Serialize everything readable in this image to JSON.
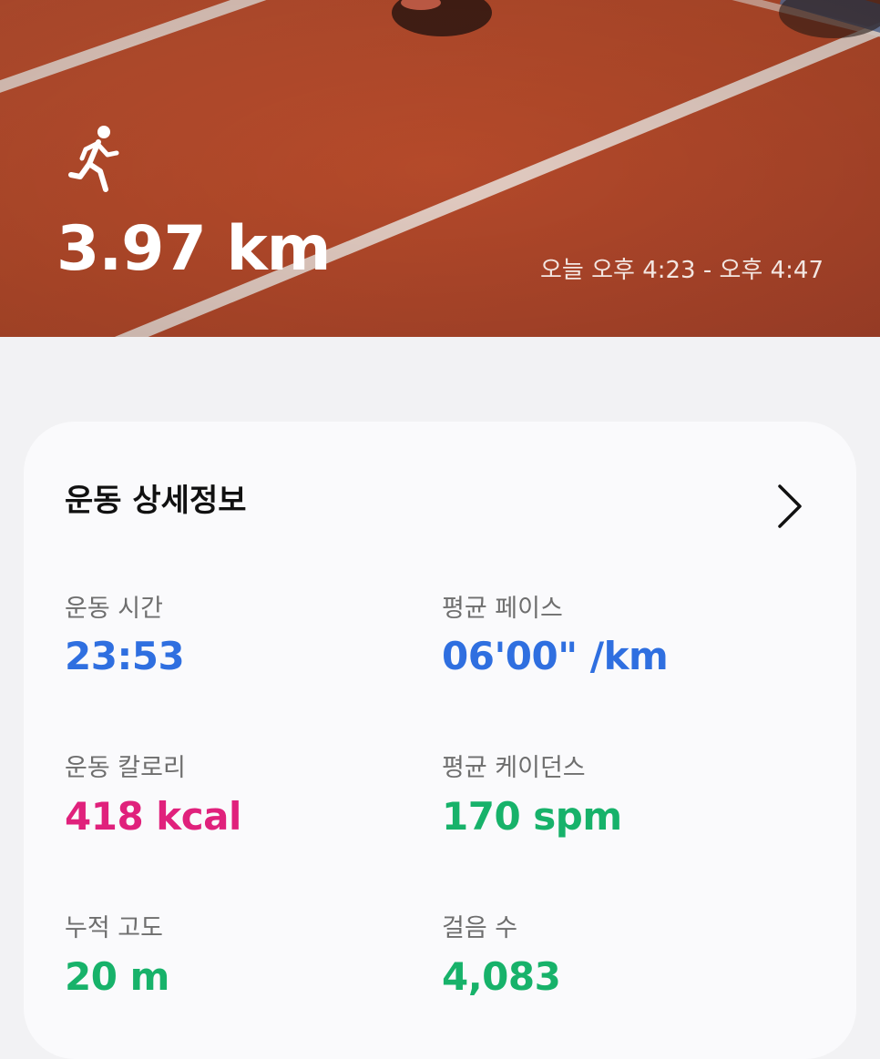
{
  "header": {
    "activity_icon": "running-person-icon",
    "distance": "3.97 km",
    "time_range": "오늘 오후 4:23 - 오후 4:47"
  },
  "details": {
    "title": "운동 상세정보",
    "chevron_icon": "chevron-right-icon",
    "stats": [
      {
        "label": "운동 시간",
        "value": "23:53",
        "color": "#2f6fe0"
      },
      {
        "label": "평균 페이스",
        "value": "06'00\" /km",
        "color": "#2f6fe0"
      },
      {
        "label": "운동 칼로리",
        "value": "418 kcal",
        "color": "#e0217c"
      },
      {
        "label": "평균 케이던스",
        "value": "170 spm",
        "color": "#17b26a"
      },
      {
        "label": "누적 고도",
        "value": "20 m",
        "color": "#17b26a"
      },
      {
        "label": "걸음 수",
        "value": "4,083",
        "color": "#17b26a"
      }
    ]
  }
}
